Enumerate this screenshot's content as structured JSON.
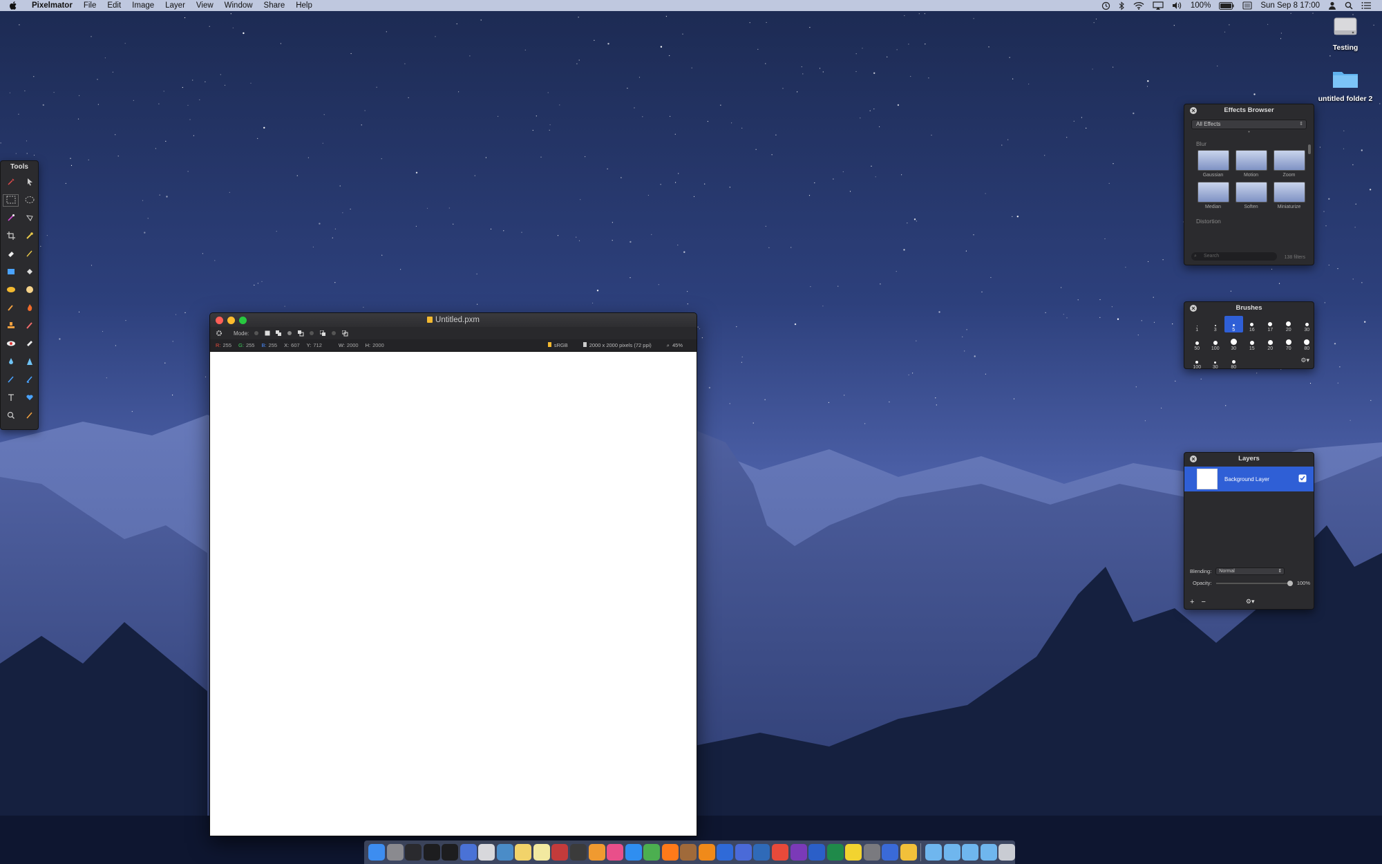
{
  "menubar": {
    "app_name": "Pixelmator",
    "menus": [
      "File",
      "Edit",
      "Image",
      "Layer",
      "View",
      "Window",
      "Share",
      "Help"
    ],
    "battery": "100%",
    "clock": "Sun Sep 8  17:00"
  },
  "desktop": {
    "icons": [
      {
        "label": "Testing",
        "type": "disk"
      },
      {
        "label": "untitled folder 2",
        "type": "folder"
      }
    ]
  },
  "tools": {
    "title": "Tools"
  },
  "document": {
    "title": "Untitled.pxm",
    "mode_label": "Mode:",
    "info": {
      "r_label": "R:",
      "r": "255",
      "g_label": "G:",
      "g": "255",
      "b_label": "B:",
      "b": "255",
      "x_label": "X:",
      "x": "607",
      "y_label": "Y:",
      "y": "712",
      "w_label": "W:",
      "w": "2000",
      "h_label": "H:",
      "h": "2000",
      "color_profile": "sRGB",
      "size": "2000 x 2000 pixels (72 ppi)",
      "zoom": "45%"
    }
  },
  "effects_browser": {
    "title": "Effects Browser",
    "filter": "All Effects",
    "sections": [
      {
        "name": "Blur",
        "effects": [
          "Gaussian",
          "Motion",
          "Zoom",
          "Median",
          "Soften",
          "Miniaturize"
        ]
      },
      {
        "name": "Distortion",
        "effects": []
      }
    ],
    "search_placeholder": "Search",
    "count": "138 filters"
  },
  "brushes": {
    "title": "Brushes",
    "items": [
      "1",
      "3",
      "5",
      "16",
      "17",
      "20",
      "30",
      "50",
      "100",
      "30",
      "15",
      "20",
      "70",
      "80",
      "100",
      "30",
      "80"
    ],
    "selected_index": 2
  },
  "layers": {
    "title": "Layers",
    "items": [
      {
        "name": "Background Layer",
        "visible": true
      }
    ],
    "blending_label": "Blending:",
    "blending_value": "Normal",
    "opacity_label": "Opacity:",
    "opacity_value": "100%"
  },
  "dock": {
    "apps": [
      "finder-icon",
      "system-preferences-icon",
      "activity-monitor-icon",
      "terminal-icon",
      "terminal-icon",
      "xcode-icon",
      "drive-icon",
      "preview-icon",
      "notes-icon",
      "notes-icon",
      "photo-booth-icon",
      "quicktime-icon",
      "ibooks-icon",
      "itunes-icon",
      "safari-icon",
      "chrome-icon",
      "firefox-icon",
      "pixelmator-icon",
      "vlc-icon",
      "edge-icon",
      "screen-sharing-icon",
      "remote-desktop-icon",
      "flashcard-icon",
      "onenote-icon",
      "word-icon",
      "excel-icon",
      "stickies-icon",
      "xcode-instruments-icon",
      "browser-icon",
      "mail-icon"
    ],
    "folders": [
      "folder-icon",
      "folder-icon",
      "applications-folder-icon",
      "downloads-folder-icon",
      "trash-icon"
    ]
  },
  "colors": {
    "accent": "#2f5fd6",
    "panel": "#2b2b2e",
    "close": "#ff5f57",
    "minimize": "#febc2e",
    "zoom": "#28c840"
  }
}
